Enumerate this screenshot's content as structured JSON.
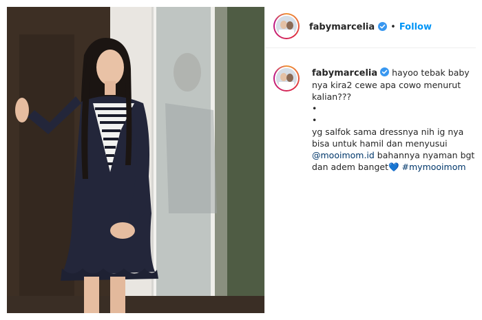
{
  "header": {
    "username": "fabymarcelia",
    "separator": "•",
    "follow_label": "Follow"
  },
  "post": {
    "username": "fabymarcelia",
    "caption_lines": [
      "hayoo tebak baby",
      "nya kira2 cewe apa cowo menurut",
      "kalian???",
      "•",
      "•",
      "yg salfok sama dressnya nih ig nya",
      "bisa untuk hamil dan menyusui"
    ],
    "mention": "@mooimom.id",
    "after_mention": " bahannya nyaman bgt",
    "line_final_text": "dan adem banget",
    "heart_emoji": "💙",
    "hashtag": "#mymooimom"
  },
  "icons": {
    "verified": "verified-badge-icon",
    "heart": "blue-heart-icon"
  },
  "colors": {
    "follow_blue": "#0095f6",
    "verified_blue": "#3897f0",
    "text": "#262626",
    "link": "#00376b"
  }
}
